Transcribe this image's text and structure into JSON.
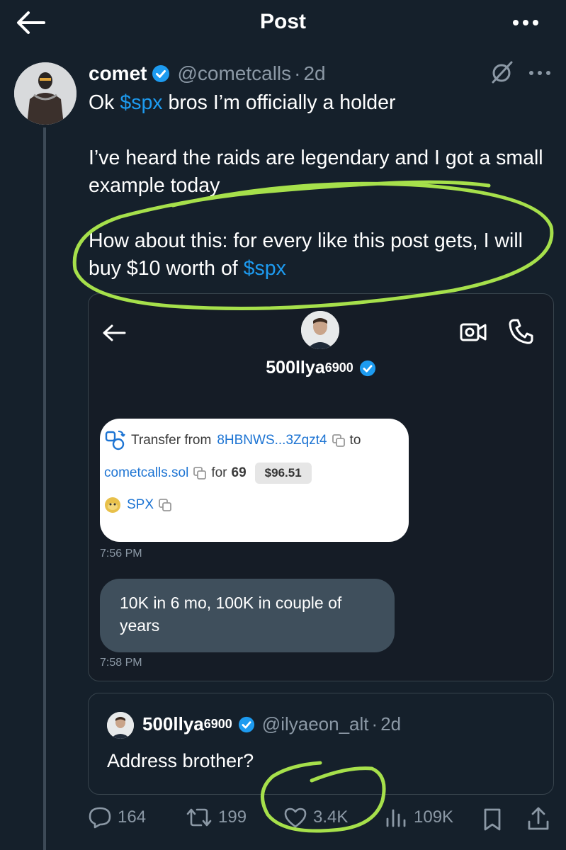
{
  "header": {
    "title": "Post"
  },
  "post": {
    "author_name": "comet",
    "handle": "@cometcalls",
    "separator": "·",
    "age": "2d",
    "text": {
      "line1_pre": "Ok ",
      "line1_tag": "$spx",
      "line1_post": " bros I’m officially a holder",
      "para2": "I’ve heard the raids are legendary and I got a small example today",
      "para3_pre": "How about this: for every like this post gets, I will buy $10 worth of ",
      "para3_tag": "$spx"
    }
  },
  "embed": {
    "contact_name": "500llya",
    "contact_sup": "6900",
    "transfer": {
      "label": "Transfer from",
      "from_address": "8HBNWS...3Zqzt4",
      "to_word": "to",
      "to_address": "cometcalls.sol",
      "for_word": "for",
      "amount": "69",
      "usd_value": "$96.51",
      "token": "SPX"
    },
    "time1": "7:56 PM",
    "message": "10K in 6 mo, 100K in couple of years",
    "time2": "7:58 PM"
  },
  "quote": {
    "author_name": "500llya",
    "author_sup": "6900",
    "handle": "@ilyaeon_alt",
    "separator": "·",
    "age": "2d",
    "text": "Address brother?"
  },
  "actions": {
    "replies": "164",
    "reposts": "199",
    "likes": "3.4K",
    "views": "109K"
  },
  "colors": {
    "background": "#15202b",
    "accent": "#1d9bf0",
    "annotation": "#a6e04b",
    "muted": "#8b98a5"
  },
  "icons": [
    "back-arrow-icon",
    "more-icon",
    "verified-icon",
    "grok-icon",
    "video-call-icon",
    "phone-icon",
    "copy-icon",
    "transfer-icon",
    "token-icon",
    "reply-icon",
    "repost-icon",
    "like-icon",
    "views-icon",
    "bookmark-icon",
    "share-icon"
  ]
}
